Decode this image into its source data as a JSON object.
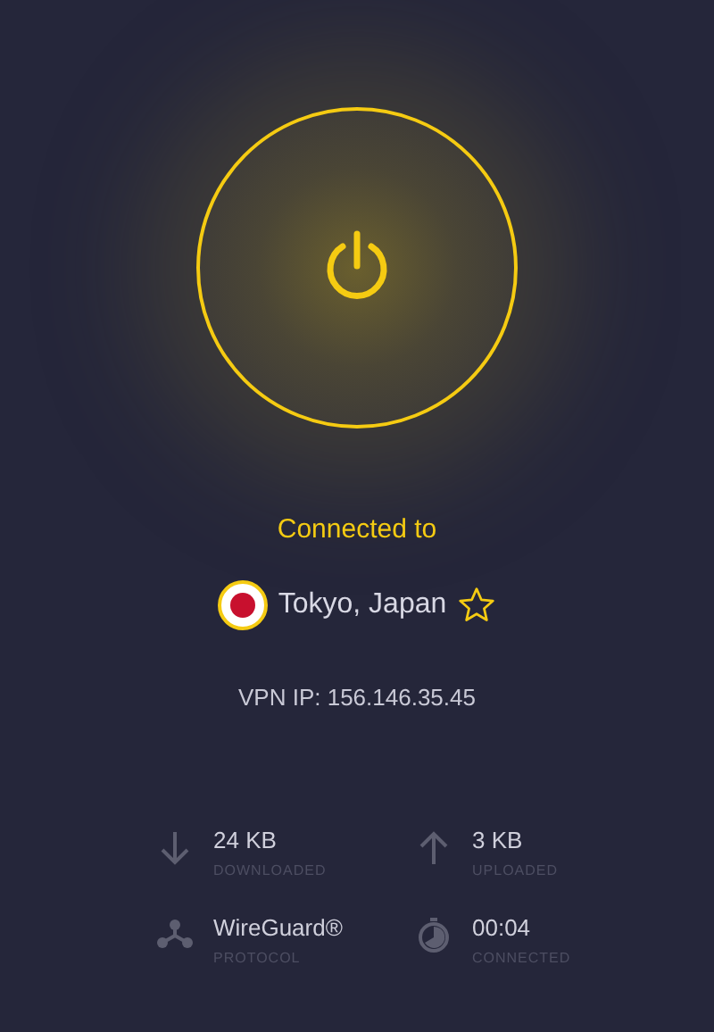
{
  "connection": {
    "connected": true,
    "status": "Connected to"
  },
  "location": {
    "name": "Tokyo, Japan",
    "favorite": false
  },
  "ip": "VPN IP: 156.146.35.45",
  "stats": [
    {
      "kind": "download",
      "value": "24 KB",
      "label": "DOWNLOADED"
    },
    {
      "kind": "upload",
      "value": "3 KB",
      "label": "UPLOADED"
    },
    {
      "kind": "protocol",
      "value": "WireGuard®",
      "label": "PROTOCOL"
    },
    {
      "kind": "timer",
      "value": "00:04",
      "label": "CONNECTED"
    }
  ]
}
